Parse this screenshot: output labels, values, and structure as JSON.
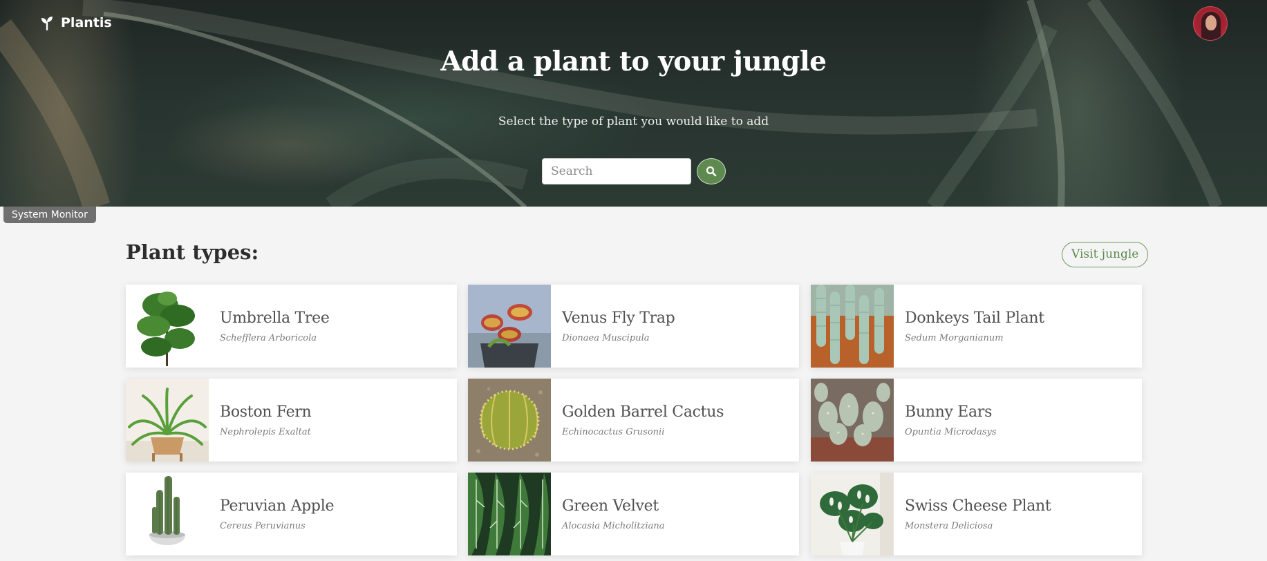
{
  "header": {
    "brand_name": "Plantis",
    "brand_icon": "sprout-icon",
    "avatar_icon": "user-avatar"
  },
  "hero": {
    "title": "Add a plant to your jungle",
    "subtitle": "Select the type of plant you would like to add",
    "search_placeholder": "Search",
    "search_value": "",
    "search_icon": "search-icon",
    "accent_color": "#5e8a4f"
  },
  "system_monitor": {
    "label": "System Monitor"
  },
  "section": {
    "title": "Plant types:",
    "visit_label": "Visit jungle"
  },
  "plants": [
    {
      "name": "Umbrella Tree",
      "latin": "Schefflera Arboricola"
    },
    {
      "name": "Venus Fly Trap",
      "latin": "Dionaea Muscipula"
    },
    {
      "name": "Donkeys Tail Plant",
      "latin": "Sedum Morganianum"
    },
    {
      "name": "Boston Fern",
      "latin": "Nephrolepis Exaltat"
    },
    {
      "name": "Golden Barrel Cactus",
      "latin": "Echinocactus Grusonii"
    },
    {
      "name": "Bunny Ears",
      "latin": "Opuntia Microdasys"
    },
    {
      "name": "Peruvian Apple",
      "latin": "Cereus Peruvianus"
    },
    {
      "name": "Green Velvet",
      "latin": "Alocasia Micholitziana"
    },
    {
      "name": "Swiss Cheese Plant",
      "latin": "Monstera Deliciosa"
    }
  ]
}
